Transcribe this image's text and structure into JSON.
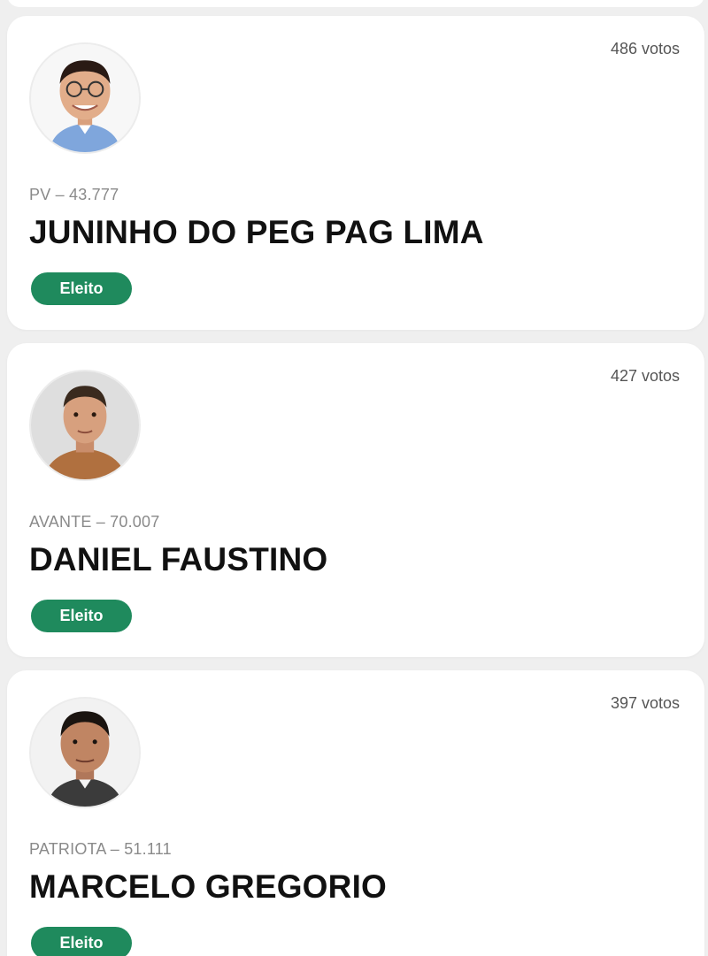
{
  "candidates": [
    {
      "votes": "486 votos",
      "party": "PV – 43.777",
      "name": "JUNINHO DO PEG PAG LIMA",
      "status": "Eleito",
      "status_color": "#1f8a5d"
    },
    {
      "votes": "427 votos",
      "party": "AVANTE – 70.007",
      "name": "DANIEL FAUSTINO",
      "status": "Eleito",
      "status_color": "#1f8a5d"
    },
    {
      "votes": "397 votos",
      "party": "PATRIOTA – 51.111",
      "name": "MARCELO GREGORIO",
      "status": "Eleito",
      "status_color": "#1f8a5d"
    }
  ]
}
